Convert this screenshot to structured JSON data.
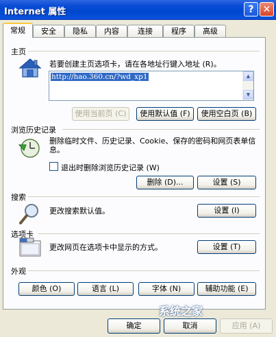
{
  "window": {
    "title": "Internet 属性",
    "help_label": "?",
    "close_label": "✕"
  },
  "tabs": [
    {
      "label": "常规"
    },
    {
      "label": "安全"
    },
    {
      "label": "隐私"
    },
    {
      "label": "内容"
    },
    {
      "label": "连接"
    },
    {
      "label": "程序"
    },
    {
      "label": "高级"
    }
  ],
  "home": {
    "title": "主页",
    "description": "若要创建主页选项卡，请在各地址行键入地址 (R)。",
    "url": "http://hao.360.cn/?wd_xp1",
    "use_current_label": "使用当前页 (C)",
    "use_default_label": "使用默认值 (F)",
    "use_blank_label": "使用空白页 (B)"
  },
  "history": {
    "title": "浏览历史记录",
    "description": "删除临时文件、历史记录、Cookie、保存的密码和网页表单信息。",
    "checkbox_label": "退出时删除浏览历史记录 (W)",
    "delete_label": "删除 (D)...",
    "settings_label": "设置 (S)"
  },
  "search": {
    "title": "搜索",
    "description": "更改搜索默认值。",
    "settings_label": "设置 (I)"
  },
  "tabs_section": {
    "title": "选项卡",
    "description": "更改网页在选项卡中显示的方式。",
    "settings_label": "设置 (T)"
  },
  "appearance": {
    "title": "外观",
    "colors_label": "颜色 (O)",
    "languages_label": "语言 (L)",
    "fonts_label": "字体 (N)",
    "accessibility_label": "辅助功能 (E)"
  },
  "dialog": {
    "ok_label": "确定",
    "cancel_label": "取消",
    "apply_label": "应用 (A)"
  },
  "watermark": "系统之家",
  "colors": {
    "titlebar": "#0047cf",
    "accent_tab": "#ffc83c",
    "selection": "#316ac5"
  }
}
